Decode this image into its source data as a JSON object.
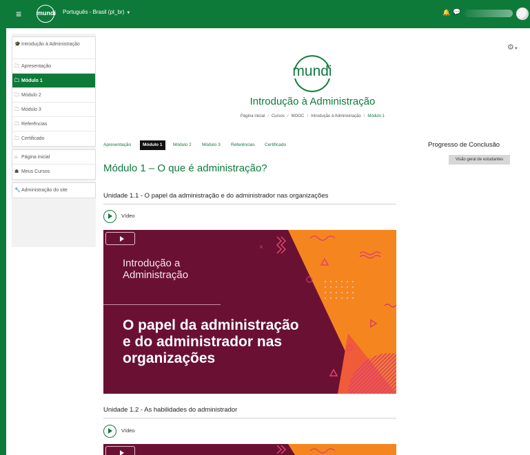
{
  "navbar": {
    "menu_icon": "≡",
    "logo_text": "mundi",
    "language": "Português - Brasil (pt_br)",
    "bell_icon": "bell-icon",
    "message_icon": "chat-icon"
  },
  "sidebar": {
    "items": [
      {
        "label": "Introdução à Administração",
        "icon": "graduation-cap-icon",
        "glyph": "🎓"
      },
      {
        "label": "Apresentação",
        "icon": "folder-icon",
        "glyph": "🗀"
      },
      {
        "label": "Módulo 1",
        "icon": "folder-icon",
        "glyph": "🗀",
        "active": true
      },
      {
        "label": "Módulo 2",
        "icon": "folder-icon",
        "glyph": "🗀"
      },
      {
        "label": "Módulo 3",
        "icon": "folder-icon",
        "glyph": "🗀"
      },
      {
        "label": "Referências",
        "icon": "folder-icon",
        "glyph": "🗀"
      },
      {
        "label": "Certificado",
        "icon": "folder-icon",
        "glyph": "🗀"
      }
    ],
    "nav": [
      {
        "label": "Página inicial",
        "icon": "home-icon",
        "glyph": "⌂"
      },
      {
        "label": "Meus Cursos",
        "icon": "courses-icon",
        "glyph": "☗"
      }
    ],
    "admin": [
      {
        "label": "Administração do site",
        "icon": "wrench-icon",
        "glyph": "🔧"
      }
    ]
  },
  "header": {
    "logo_text": "mundi",
    "course_title": "Introdução à Administração",
    "breadcrumb": [
      "Página inicial",
      "Cursos",
      "MOOC",
      "Introdução à Administração",
      "Módulo 1"
    ]
  },
  "tabs": [
    "Apresentação",
    "Módulo 1",
    "Módulo 2",
    "Módulo 3",
    "Referências",
    "Certificado"
  ],
  "active_tab": "Módulo 1",
  "module_title": "Módulo 1 – O que é administração?",
  "units": [
    {
      "title": "Unidade 1.1 - O papel da administração e do administrador nas organizações",
      "video_label": "Vídeo",
      "thumbnail": {
        "subtitle_line1": "Introdução a",
        "subtitle_line2": "Administração",
        "main_line1": "O papel da administração",
        "main_line2": "e do administrador nas",
        "main_line3": "organizações"
      }
    },
    {
      "title": "Unidade 1.2 - As habilidades do administrador",
      "video_label": "Vídeo"
    }
  ],
  "right": {
    "progress_title": "Progresso de Conclusão",
    "overview_button": "Visão geral de estudantes"
  },
  "colors": {
    "brand_green": "#0e7a3a",
    "thumb_burgundy": "#6a1133",
    "thumb_orange": "#f5861f"
  }
}
